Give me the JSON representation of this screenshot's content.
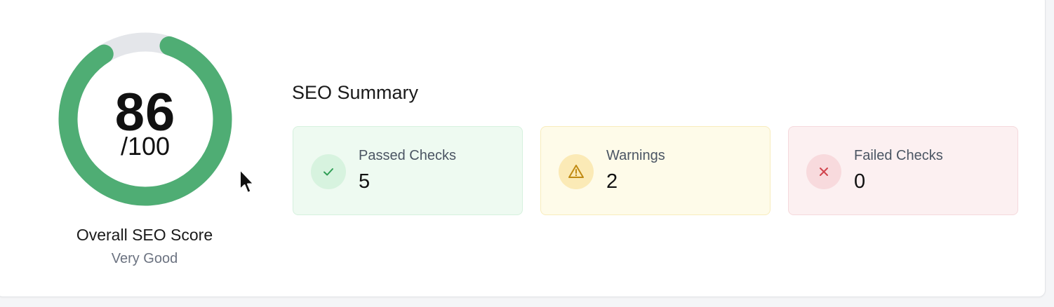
{
  "score": {
    "value": "86",
    "max": "/100",
    "progress_fraction": 0.86,
    "label": "Overall SEO Score",
    "rating": "Very Good",
    "ring_color": "#4fad74",
    "track_color": "#e4e6ea"
  },
  "summary": {
    "title": "SEO Summary",
    "stats": [
      {
        "label": "Passed Checks",
        "value": "5",
        "icon": "check-icon",
        "color": "#2f9e55"
      },
      {
        "label": "Warnings",
        "value": "2",
        "icon": "warning-triangle-icon",
        "color": "#c08a12"
      },
      {
        "label": "Failed Checks",
        "value": "0",
        "icon": "close-icon",
        "color": "#d0434c"
      }
    ]
  }
}
